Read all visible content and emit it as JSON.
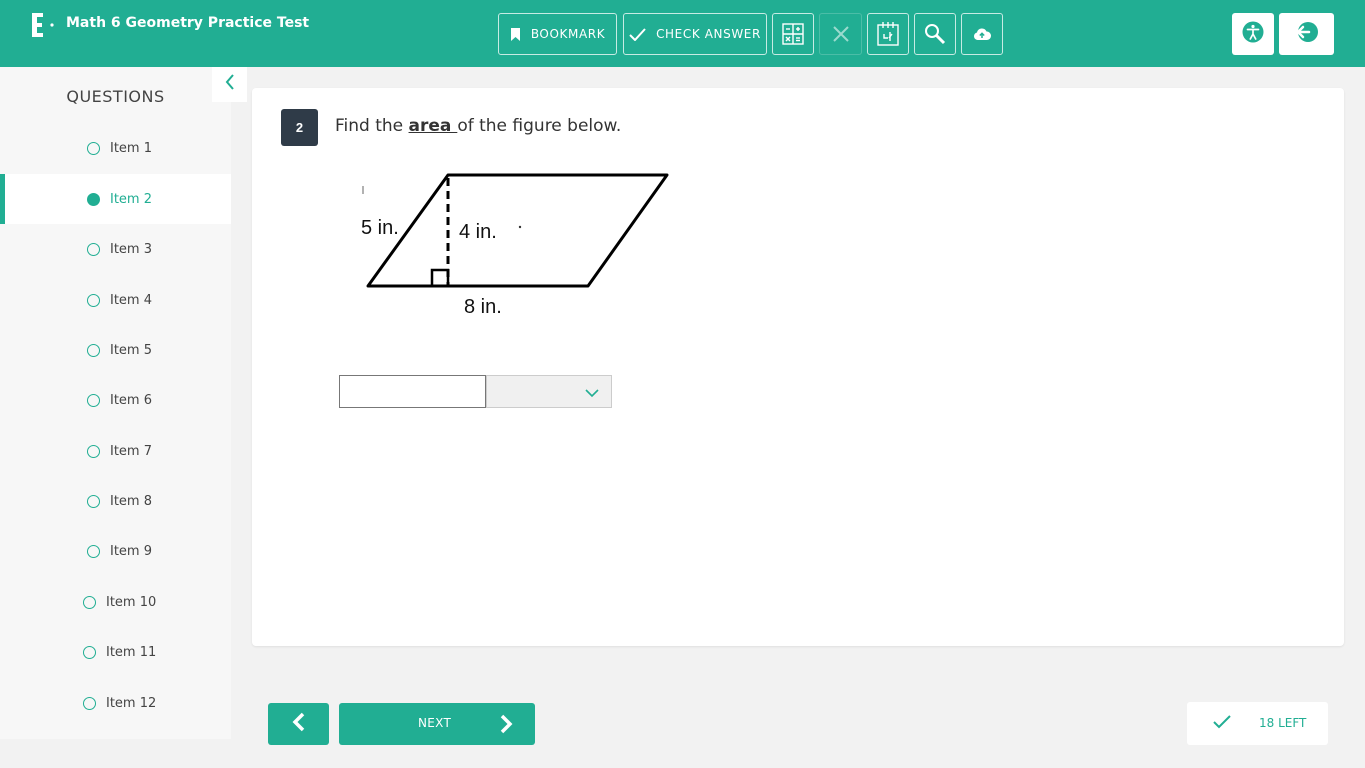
{
  "header": {
    "title": "Math 6 Geometry Practice Test",
    "toolbar": {
      "bookmark_label": "BOOKMARK",
      "check_answer_label": "CHECK ANSWER"
    }
  },
  "sidebar": {
    "title": "QUESTIONS",
    "items": [
      {
        "label": "Item 1",
        "active": false
      },
      {
        "label": "Item 2",
        "active": true
      },
      {
        "label": "Item 3",
        "active": false
      },
      {
        "label": "Item 4",
        "active": false
      },
      {
        "label": "Item 5",
        "active": false
      },
      {
        "label": "Item 6",
        "active": false
      },
      {
        "label": "Item 7",
        "active": false
      },
      {
        "label": "Item 8",
        "active": false
      },
      {
        "label": "Item 9",
        "active": false
      },
      {
        "label": "Item 10",
        "active": false
      },
      {
        "label": "Item 11",
        "active": false
      },
      {
        "label": "Item 12",
        "active": false
      }
    ]
  },
  "question": {
    "number": "2",
    "prompt_before": "Find the ",
    "prompt_emphasis": "area ",
    "prompt_after": "of the figure below.",
    "figure": {
      "side_label": "5 in.",
      "height_label": "4 in.",
      "base_label": "8 in."
    },
    "answer_value": "",
    "unit_selected": ""
  },
  "footer": {
    "next_label": "NEXT",
    "remaining_label": "18 LEFT"
  },
  "colors": {
    "brand": "#21ae93",
    "badge": "#2f3b48"
  }
}
